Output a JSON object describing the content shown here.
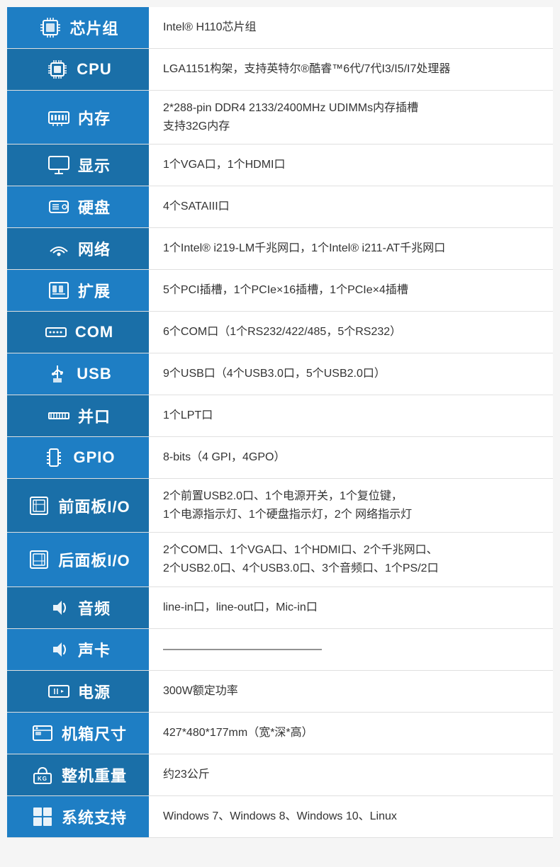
{
  "rows": [
    {
      "id": "chipset",
      "label": "芯片组",
      "icon": "chipset",
      "value": "Intel® H110芯片组"
    },
    {
      "id": "cpu",
      "label": "CPU",
      "icon": "cpu",
      "value": "LGA1151构架，支持英特尔®酷睿™6代/7代I3/I5/I7处理器"
    },
    {
      "id": "memory",
      "label": "内存",
      "icon": "memory",
      "value": "2*288-pin DDR4 2133/2400MHz UDIMMs内存插槽\n支持32G内存"
    },
    {
      "id": "display",
      "label": "显示",
      "icon": "display",
      "value": "1个VGA口，1个HDMI口"
    },
    {
      "id": "hdd",
      "label": "硬盘",
      "icon": "hdd",
      "value": "4个SATAIII口"
    },
    {
      "id": "network",
      "label": "网络",
      "icon": "network",
      "value": "1个Intel® i219-LM千兆网口，1个Intel® i211-AT千兆网口"
    },
    {
      "id": "expansion",
      "label": "扩展",
      "icon": "expansion",
      "value": "5个PCI插槽，1个PCIe×16插槽，1个PCIe×4插槽"
    },
    {
      "id": "com",
      "label": "COM",
      "icon": "com",
      "value": "6个COM口（1个RS232/422/485，5个RS232）"
    },
    {
      "id": "usb",
      "label": "USB",
      "icon": "usb",
      "value": "9个USB口（4个USB3.0口，5个USB2.0口）"
    },
    {
      "id": "parallel",
      "label": "并口",
      "icon": "parallel",
      "value": "1个LPT口"
    },
    {
      "id": "gpio",
      "label": "GPIO",
      "icon": "gpio",
      "value": "8-bits（4 GPI，4GPO）"
    },
    {
      "id": "front-io",
      "label": "前面板I/O",
      "icon": "front-io",
      "value": "2个前置USB2.0口、1个电源开关，1个复位键，\n1个电源指示灯、1个硬盘指示灯，2个 网络指示灯"
    },
    {
      "id": "rear-io",
      "label": "后面板I/O",
      "icon": "rear-io",
      "value": "2个COM口、1个VGA口、1个HDMI口、2个千兆网口、\n2个USB2.0口、4个USB3.0口、3个音频口、1个PS/2口"
    },
    {
      "id": "audio",
      "label": "音频",
      "icon": "audio",
      "value": "line-in口，line-out口，Mic-in口"
    },
    {
      "id": "soundcard",
      "label": "声卡",
      "icon": "soundcard",
      "value": "——————————————"
    },
    {
      "id": "power",
      "label": "电源",
      "icon": "power",
      "value": "300W额定功率"
    },
    {
      "id": "chassis",
      "label": "机箱尺寸",
      "icon": "chassis",
      "value": "427*480*177mm（宽*深*高）"
    },
    {
      "id": "weight",
      "label": "整机重量",
      "icon": "weight",
      "value": "约23公斤"
    },
    {
      "id": "os",
      "label": "系统支持",
      "icon": "os",
      "value": "Windows 7、Windows 8、Windows 10、Linux"
    }
  ]
}
